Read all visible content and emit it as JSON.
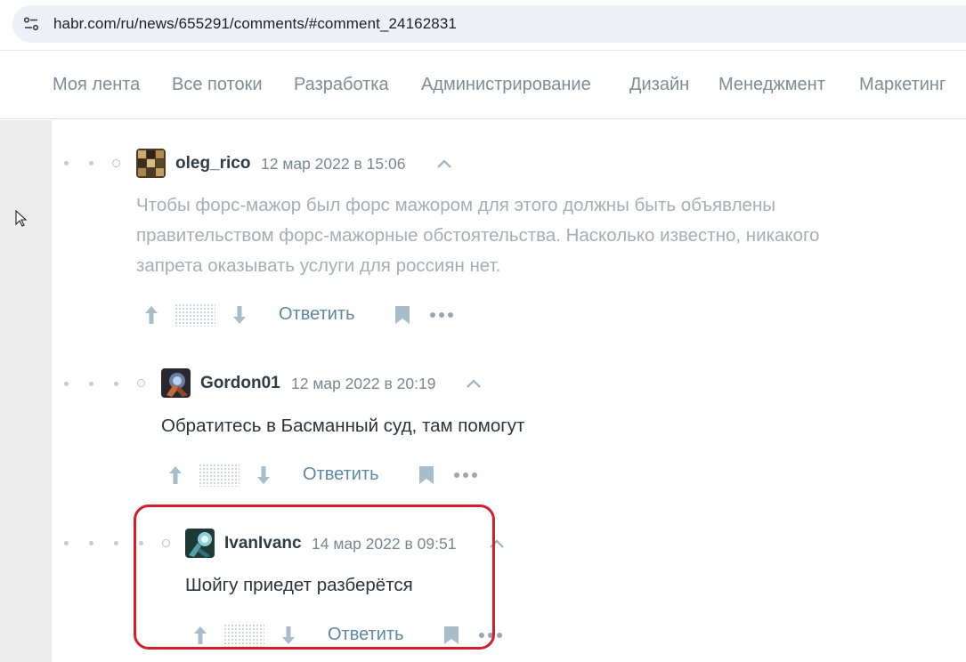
{
  "browser": {
    "url": "habr.com/ru/news/655291/comments/#comment_24162831"
  },
  "nav": {
    "items": [
      "Моя лента",
      "Все потоки",
      "Разработка",
      "Администрирование",
      "Дизайн",
      "Менеджмент",
      "Маркетинг"
    ]
  },
  "comments": [
    {
      "author": "oleg_rico",
      "date": "12 мар 2022 в 15:06",
      "lines": [
        "Чтобы форс-мажор был форс мажором для этого должны быть объявлены",
        "правительством форс-мажорные обстоятельства. Насколько известно, никакого",
        "запрета оказывать услуги для россиян нет."
      ],
      "reply_label": "Ответить"
    },
    {
      "author": "Gordon01",
      "date": "12 мар 2022 в 20:19",
      "lines": [
        "Обратитесь в Басманный суд, там помогут"
      ],
      "reply_label": "Ответить"
    },
    {
      "author": "IvanIvanc",
      "date": "14 мар 2022 в 09:51",
      "lines": [
        "Шойгу приедет разберётся"
      ],
      "reply_label": "Ответить"
    }
  ],
  "colors": {
    "highlight": "#d11f2c",
    "link": "#5e87a3"
  }
}
